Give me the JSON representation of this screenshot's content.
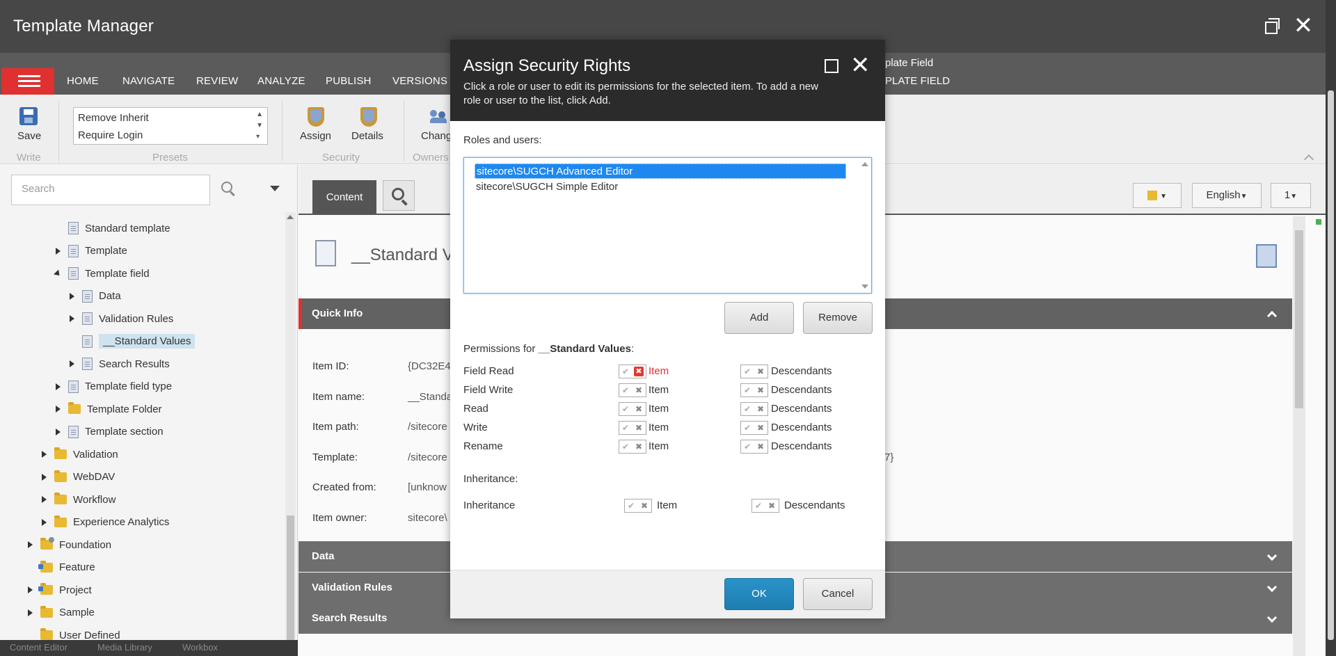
{
  "window": {
    "title": "Template Manager"
  },
  "menu": {
    "items": [
      "HOME",
      "NAVIGATE",
      "REVIEW",
      "ANALYZE",
      "PUBLISH",
      "VERSIONS"
    ],
    "extra_line1": "plate Field",
    "extra_line2": "PLATE FIELD"
  },
  "ribbon": {
    "save_label": "Save",
    "write_group": "Write",
    "presets": [
      "Remove Inherit",
      "Require Login"
    ],
    "presets_group": "Presets",
    "assign_label": "Assign",
    "details_label": "Details",
    "security_group": "Security",
    "change_label": "Chang",
    "owners_group": "Owners"
  },
  "search": {
    "placeholder": "Search"
  },
  "tree": [
    {
      "label": "Standard template",
      "depth": 3,
      "expander": "none",
      "icon": "doc"
    },
    {
      "label": "Template",
      "depth": 3,
      "expander": "right",
      "icon": "doc"
    },
    {
      "label": "Template field",
      "depth": 3,
      "expander": "down",
      "icon": "doc"
    },
    {
      "label": "Data",
      "depth": 4,
      "expander": "right",
      "icon": "doc"
    },
    {
      "label": "Validation Rules",
      "depth": 4,
      "expander": "right",
      "icon": "doc"
    },
    {
      "label": "__Standard Values",
      "depth": 4,
      "expander": "none",
      "icon": "doc",
      "selected": true
    },
    {
      "label": "Search Results",
      "depth": 4,
      "expander": "right",
      "icon": "doc"
    },
    {
      "label": "Template field type",
      "depth": 3,
      "expander": "right",
      "icon": "doc"
    },
    {
      "label": "Template Folder",
      "depth": 3,
      "expander": "right",
      "icon": "folder"
    },
    {
      "label": "Template section",
      "depth": 3,
      "expander": "right",
      "icon": "doc"
    },
    {
      "label": "Validation",
      "depth": 2,
      "expander": "right",
      "icon": "folder"
    },
    {
      "label": "WebDAV",
      "depth": 2,
      "expander": "right",
      "icon": "folder"
    },
    {
      "label": "Workflow",
      "depth": 2,
      "expander": "right",
      "icon": "folder"
    },
    {
      "label": "Experience Analytics",
      "depth": 2,
      "expander": "right",
      "icon": "folder"
    },
    {
      "label": "Foundation",
      "depth": 1,
      "expander": "right",
      "icon": "folder-special"
    },
    {
      "label": "Feature",
      "depth": 1,
      "expander": "none",
      "icon": "folder-blue"
    },
    {
      "label": "Project",
      "depth": 1,
      "expander": "right",
      "icon": "folder-blue"
    },
    {
      "label": "Sample",
      "depth": 1,
      "expander": "right",
      "icon": "folder"
    },
    {
      "label": "User Defined",
      "depth": 1,
      "expander": "none",
      "icon": "folder"
    }
  ],
  "bottom_tabs": [
    "Content Editor",
    "Media Library",
    "Workbox"
  ],
  "content": {
    "tab_label": "Content",
    "language": "English",
    "version": "1",
    "item_title": "__Standard Va",
    "quick_info": "Quick Info",
    "info": [
      {
        "label": "Item ID:",
        "value": "{DC32E4"
      },
      {
        "label": "Item name:",
        "value": "__Standa"
      },
      {
        "label": "Item path:",
        "value": "/sitecore"
      },
      {
        "label": "Template:",
        "value": "/sitecore"
      },
      {
        "label": "Created from:",
        "value": "[unknow"
      },
      {
        "label": "Item owner:",
        "value": "sitecore\\"
      }
    ],
    "template_suffix": "7}",
    "sections": [
      "Data",
      "Validation Rules",
      "Search Results"
    ]
  },
  "dialog": {
    "title": "Assign Security Rights",
    "description": "Click a role or user to edit its permissions for the selected item. To add a new role or user to the list, click Add.",
    "roles_label": "Roles and users:",
    "roles": [
      "sitecore\\SUGCH Advanced Editor",
      "sitecore\\SUGCH Simple Editor"
    ],
    "add_label": "Add",
    "remove_label": "Remove",
    "permissions_prefix": "Permissions for ",
    "permissions_item": "__Standard Values",
    "permissions_suffix": ":",
    "item_word": "Item",
    "descendants_word": "Descendants",
    "permissions": [
      {
        "name": "Field Read",
        "item_denied": true
      },
      {
        "name": "Field Write",
        "item_denied": false
      },
      {
        "name": "Read",
        "item_denied": false
      },
      {
        "name": "Write",
        "item_denied": false
      },
      {
        "name": "Rename",
        "item_denied": false
      }
    ],
    "inheritance_label": "Inheritance:",
    "inheritance_name": "Inheritance",
    "ok_label": "OK",
    "cancel_label": "Cancel"
  }
}
